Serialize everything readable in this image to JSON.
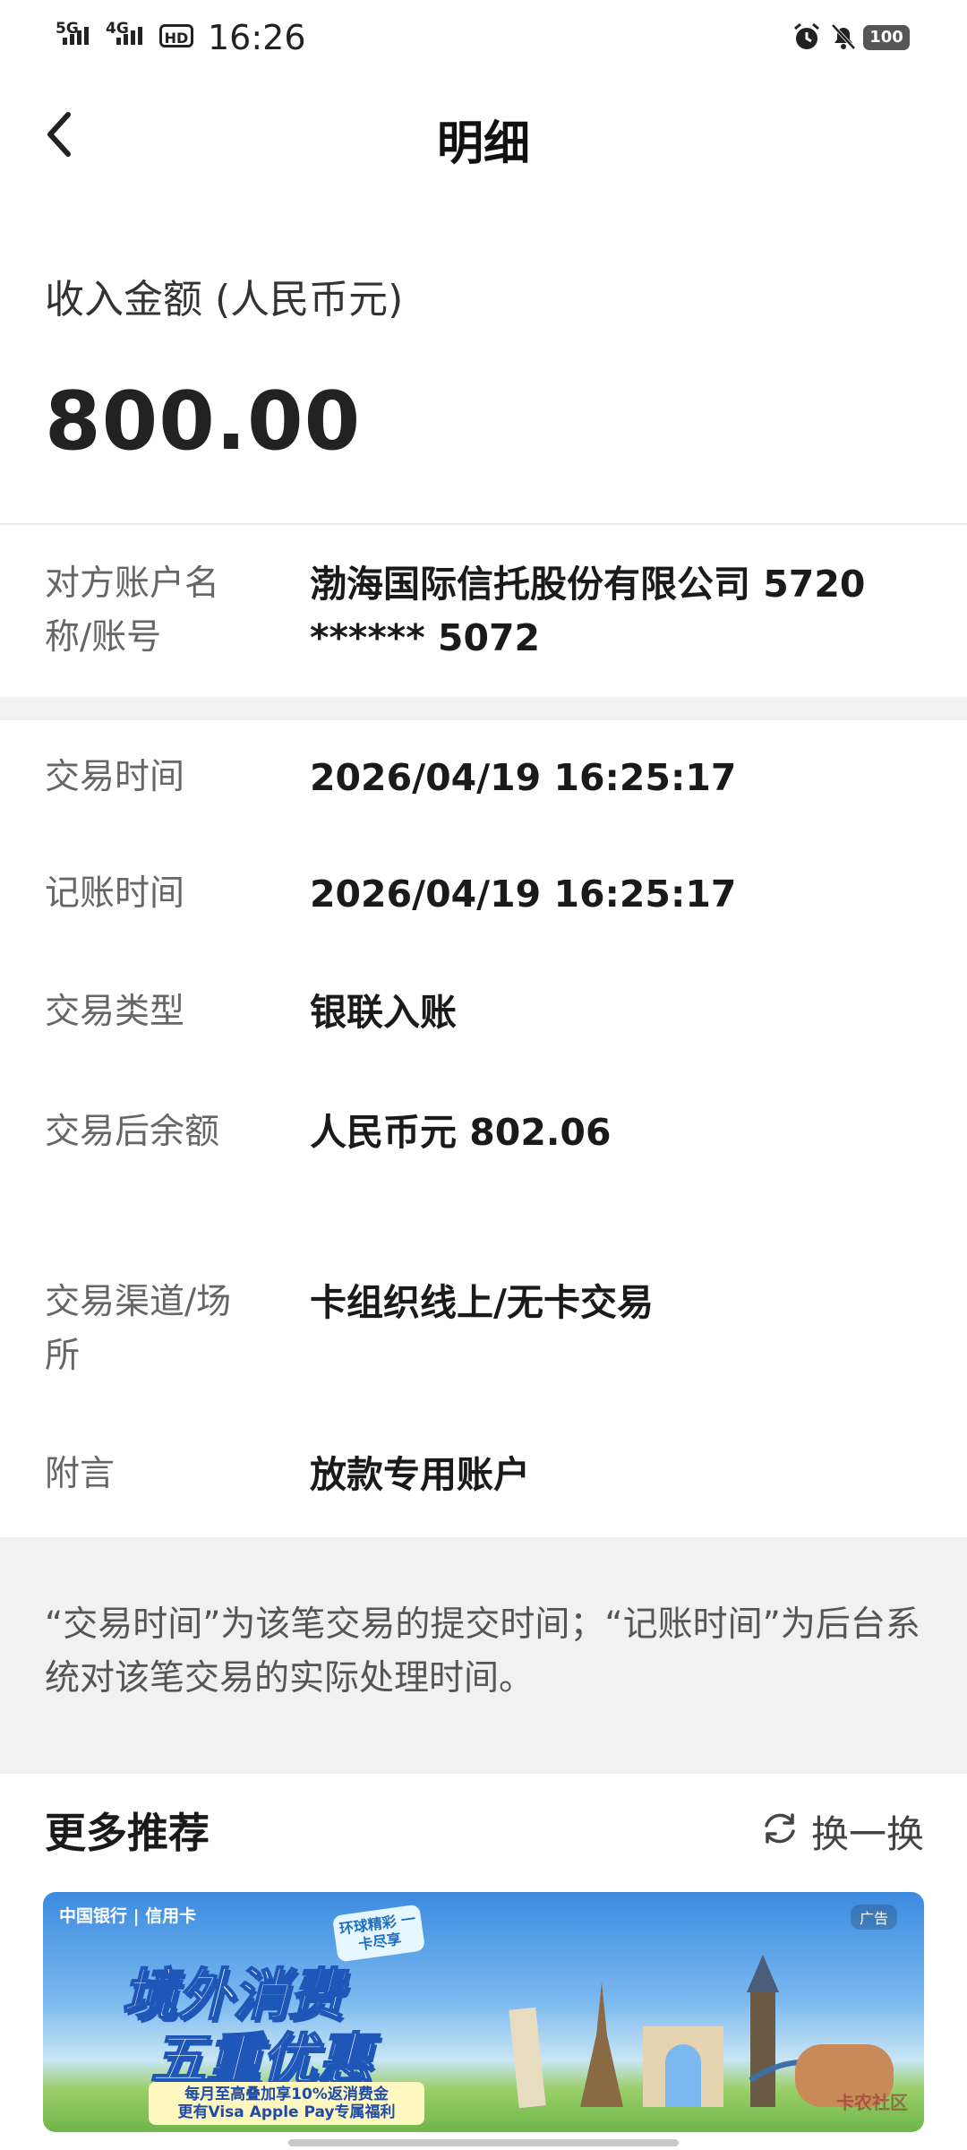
{
  "status_bar": {
    "sim1": "5G",
    "sim2": "4G",
    "hd": "HD",
    "time": "16:26",
    "battery": "100",
    "icons": [
      "alarm-icon",
      "bell-off-icon",
      "battery-icon"
    ]
  },
  "header": {
    "title": "明细"
  },
  "amount": {
    "label": "收入金额 (人民币元)",
    "value": "800.00"
  },
  "counterparty": {
    "label": "对方账户名称/账号",
    "value": "渤海国际信托股份有限公司 5720 ****** 5072"
  },
  "details": [
    {
      "label": "交易时间",
      "value": "2026/04/19 16:25:17"
    },
    {
      "label": "记账时间",
      "value": "2026/04/19 16:25:17"
    },
    {
      "label": "交易类型",
      "value": "银联入账"
    },
    {
      "label": "交易后余额",
      "value": "人民币元 802.06"
    },
    {
      "label": "交易渠道/场所",
      "value": "卡组织线上/无卡交易"
    },
    {
      "label": "附言",
      "value": "放款专用账户"
    }
  ],
  "note": "“交易时间”为该笔交易的提交时间；“记账时间”为后台系统对该笔交易的实际处理时间。",
  "recommend": {
    "title": "更多推荐",
    "refresh_label": "换一换",
    "banner": {
      "brand": "中国银行 | 信用卡",
      "ad_label": "广告",
      "tag": "环球精彩 一卡尽享",
      "headline1": "境外消费",
      "headline2": "五重优惠",
      "sub1": "每月至高叠加享10%返消费金",
      "sub2": "更有Visa Apple Pay专属福利",
      "watermark": "卡农社区"
    }
  }
}
